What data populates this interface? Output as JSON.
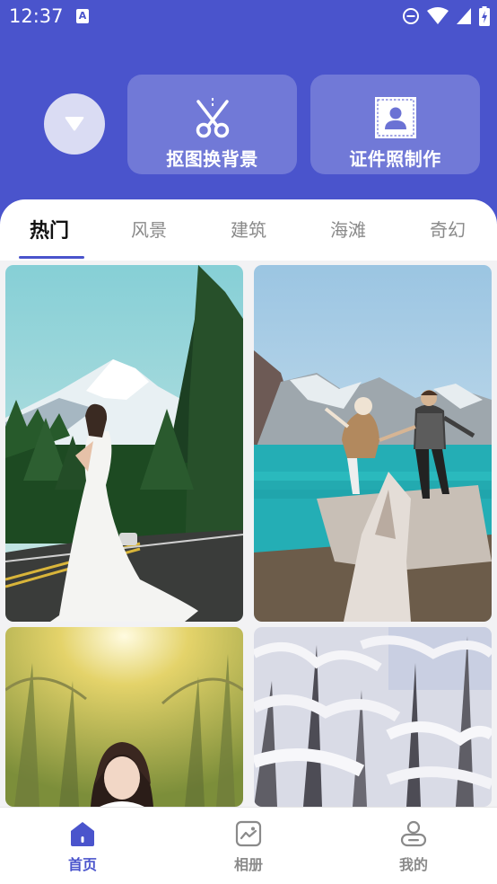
{
  "status_bar": {
    "time": "12:37",
    "notification_letter": "A",
    "icons": [
      "do-not-disturb-icon",
      "wifi-icon",
      "signal-icon",
      "battery-charging-icon"
    ]
  },
  "header": {
    "dropdown_icon": "triangle-down-icon",
    "features": [
      {
        "label": "抠图换背景",
        "icon": "scissors-icon"
      },
      {
        "label": "证件照制作",
        "icon": "id-photo-icon"
      }
    ]
  },
  "tabs": [
    {
      "label": "热门",
      "active": true
    },
    {
      "label": "风景",
      "active": false
    },
    {
      "label": "建筑",
      "active": false
    },
    {
      "label": "海滩",
      "active": false
    },
    {
      "label": "奇幻",
      "active": false
    }
  ],
  "photos": [
    {
      "subject": "mountain-road-wedding-photo"
    },
    {
      "subject": "lake-couple-photo"
    },
    {
      "subject": "sunlit-forest-girl-photo"
    },
    {
      "subject": "snowy-forest-photo"
    }
  ],
  "bottom_nav": [
    {
      "label": "首页",
      "icon": "home-icon",
      "active": true
    },
    {
      "label": "相册",
      "icon": "album-icon",
      "active": false
    },
    {
      "label": "我的",
      "icon": "profile-icon",
      "active": false
    }
  ],
  "colors": {
    "accent": "#4a54cc",
    "tab_inactive": "#8a8a8a",
    "nav_inactive": "#8a8a8a"
  }
}
